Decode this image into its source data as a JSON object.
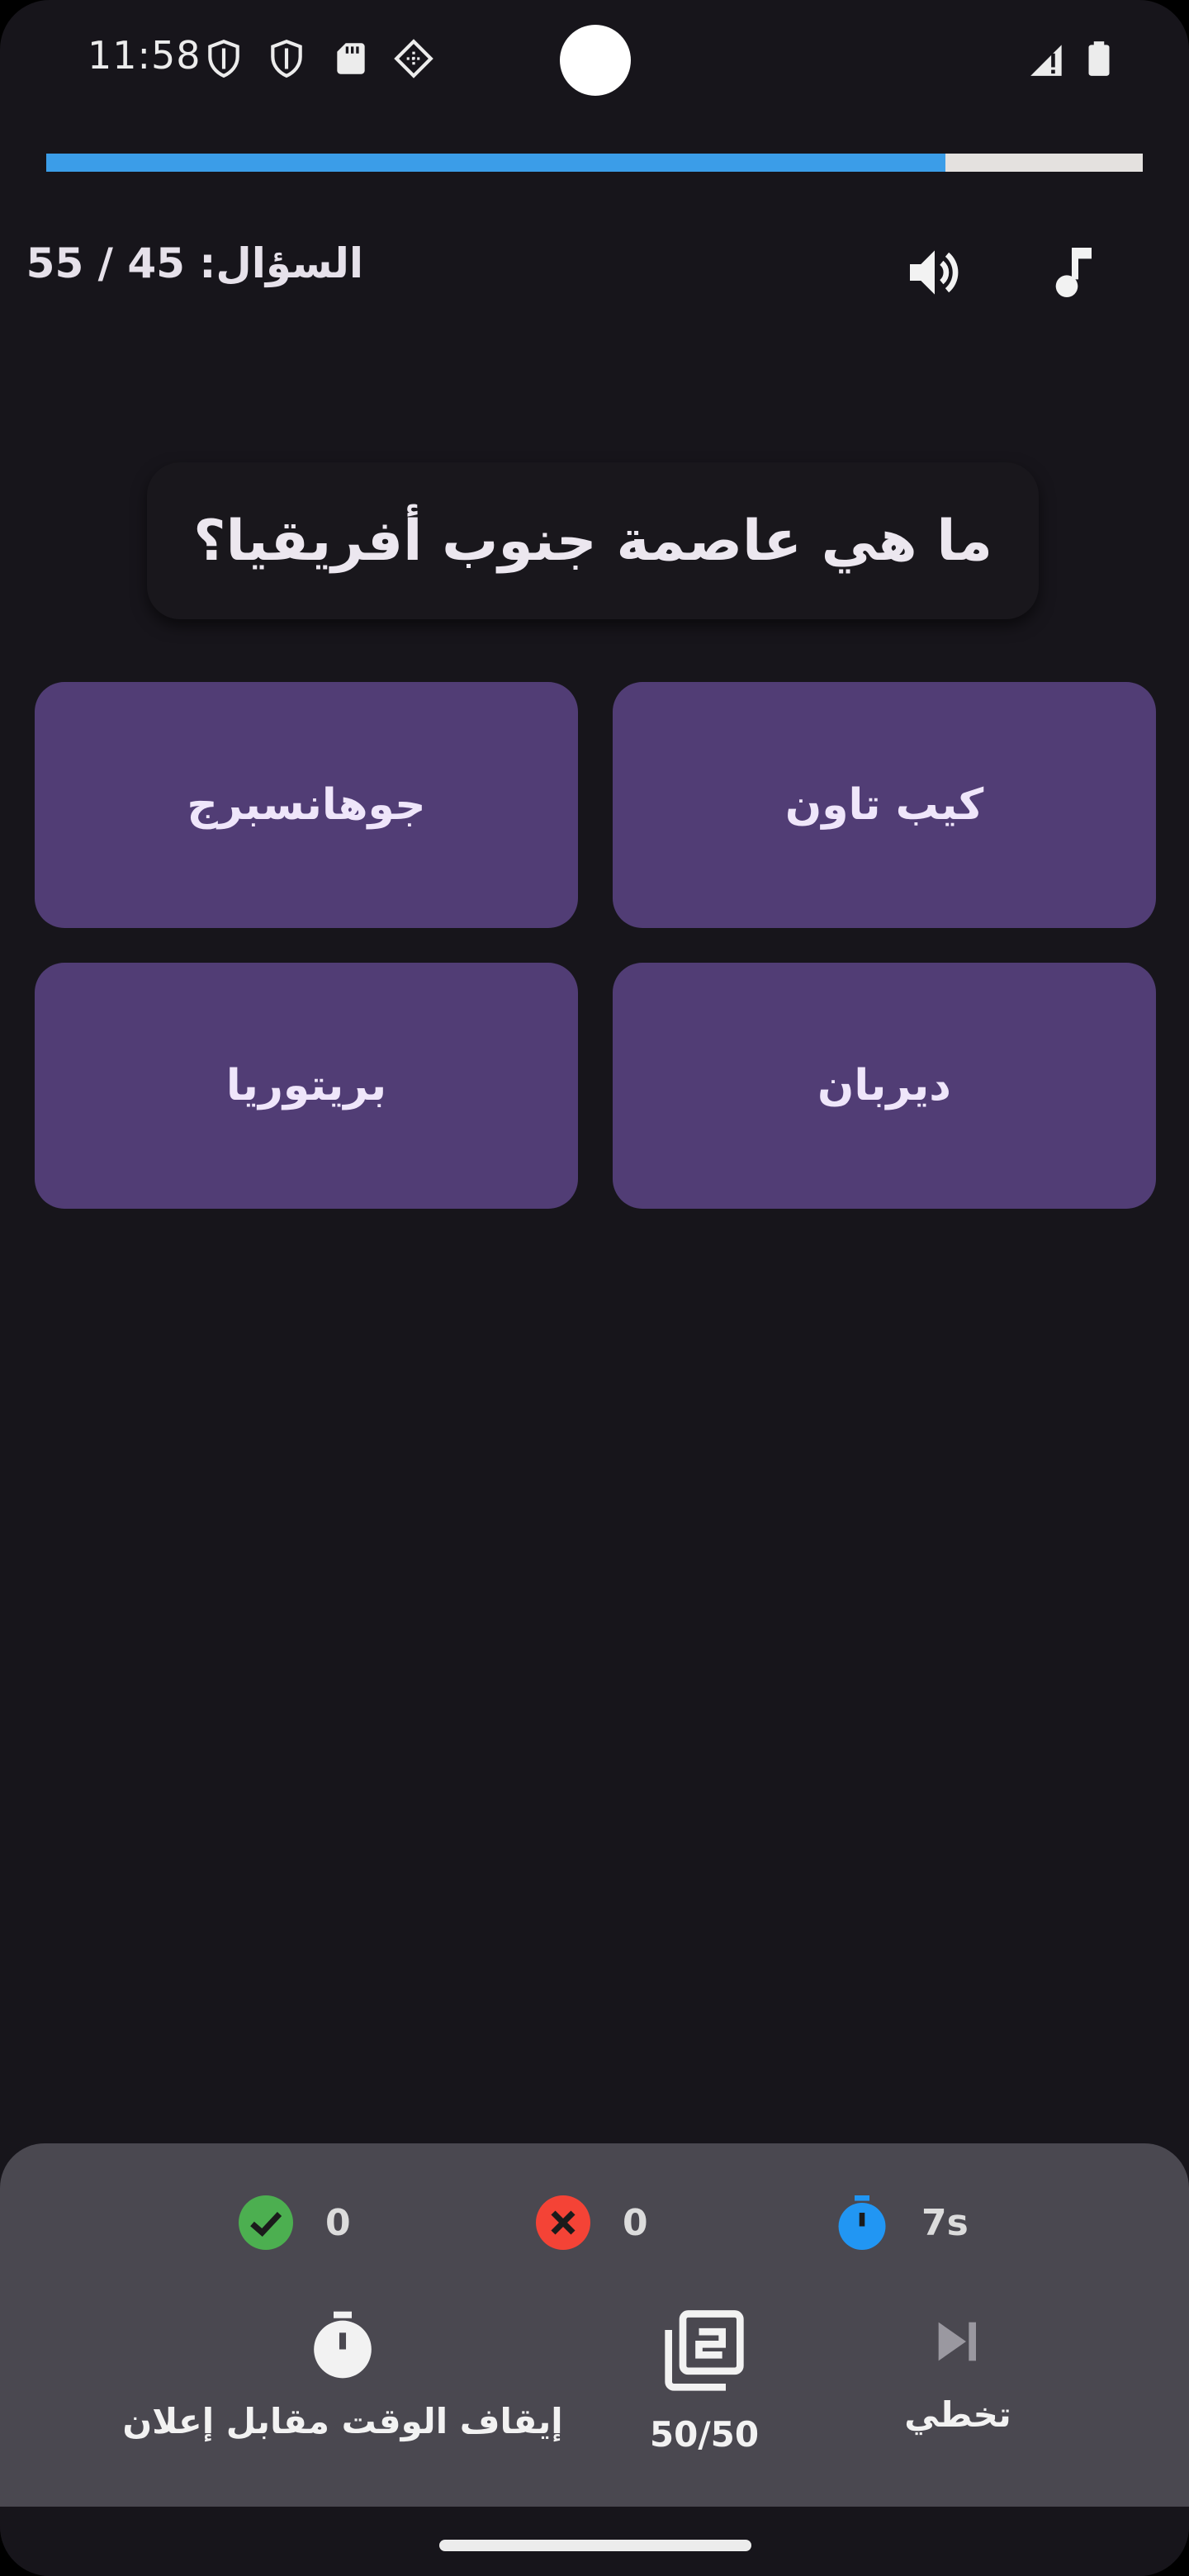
{
  "status_bar": {
    "time": "11:58",
    "icons": [
      "shield-icon",
      "shield-icon",
      "sd-card-icon",
      "cast-diamond-icon",
      "signal-icon",
      "battery-icon"
    ]
  },
  "progress": {
    "fraction": 0.82,
    "color": "#3b9de8"
  },
  "header": {
    "question_counter": "السؤال: 45 / 55",
    "icons": [
      "volume-icon",
      "music-note-icon"
    ]
  },
  "question": {
    "text": "ما هي عاصمة جنوب أفريقيا؟"
  },
  "answers": [
    {
      "label": "كيب تاون"
    },
    {
      "label": "جوهانسبرج"
    },
    {
      "label": "ديربان"
    },
    {
      "label": "بريتوريا"
    }
  ],
  "stats": {
    "correct": "0",
    "wrong": "0",
    "time": "7s",
    "colors": {
      "correct": "#4caf50",
      "wrong": "#f44336",
      "time": "#2196f3"
    }
  },
  "lifelines": {
    "skip": "تخطي",
    "fifty_fifty": "50/50",
    "pause_time": "إيقاف الوقت مقابل إعلان"
  }
}
